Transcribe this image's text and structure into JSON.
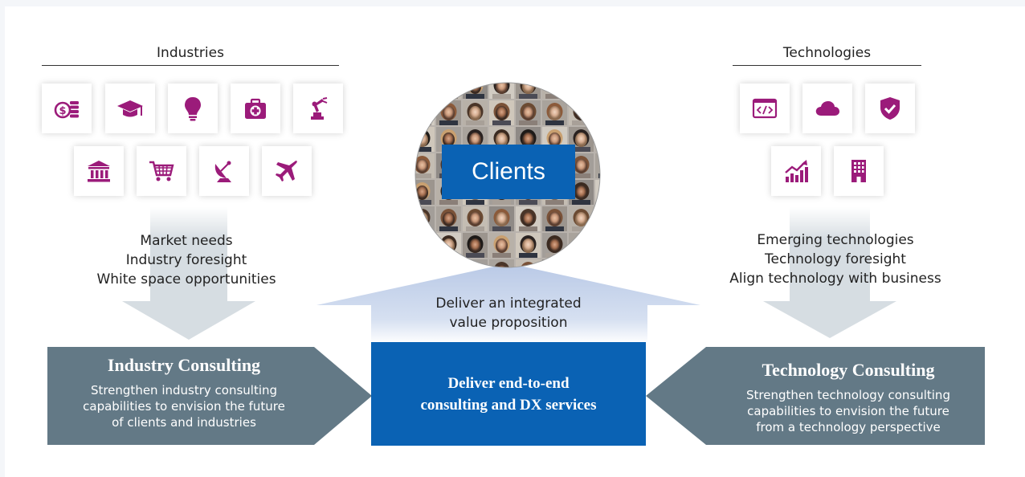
{
  "industries": {
    "title": "Industries",
    "icons": [
      "money-icon",
      "graduation-cap-icon",
      "lightbulb-icon",
      "medical-kit-icon",
      "robot-arm-icon",
      "bank-icon",
      "shopping-cart-icon",
      "satellite-dish-icon",
      "airplane-icon"
    ],
    "arrow_lines": [
      "Market needs",
      "Industry foresight",
      "White space opportunities"
    ]
  },
  "technologies": {
    "title": "Technologies",
    "icons": [
      "code-window-icon",
      "cloud-icon",
      "shield-check-icon",
      "growth-chart-icon",
      "office-building-icon"
    ],
    "arrow_lines": [
      "Emerging technologies",
      "Technology foresight",
      "Align technology with business"
    ]
  },
  "clients": {
    "label": "Clients"
  },
  "up_arrow": {
    "lines": [
      "Deliver an integrated",
      "value proposition"
    ]
  },
  "industry_consulting": {
    "title": "Industry Consulting",
    "lines": [
      "Strengthen industry consulting",
      "capabilities to envision the future",
      "of clients and industries"
    ]
  },
  "technology_consulting": {
    "title": "Technology Consulting",
    "lines": [
      "Strengthen technology consulting",
      "capabilities to envision the future",
      "from a technology perspective"
    ]
  },
  "center": {
    "lines": [
      "Deliver end-to-end",
      "consulting and DX services"
    ]
  },
  "colors": {
    "icon": "#9b1b7a",
    "slate": "#637986",
    "blue": "#0a62b4",
    "arrow_gray": "#c8d2d8",
    "arrow_blue": "#b9c9e6"
  }
}
